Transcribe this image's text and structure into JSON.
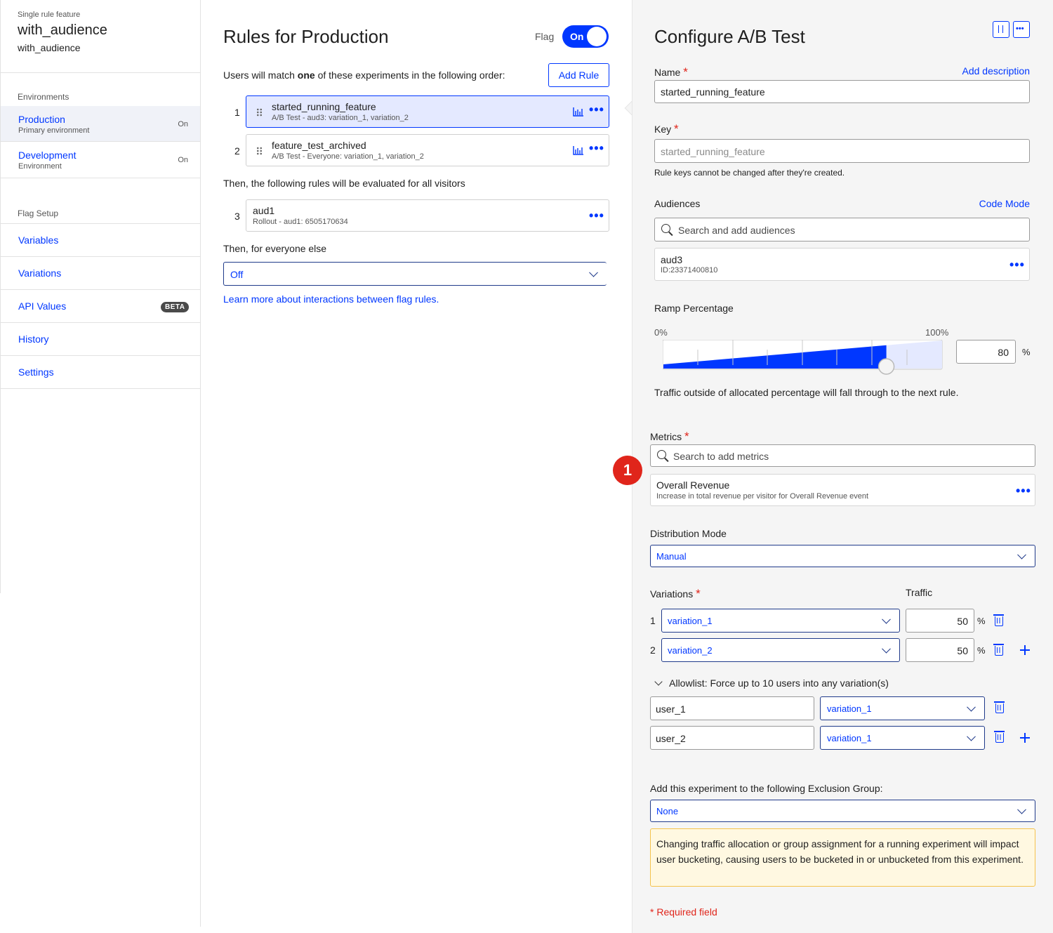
{
  "sidebar": {
    "feature_type": "Single rule feature",
    "feature_name": "with_audience",
    "feature_key": "with_audience",
    "environments_heading": "Environments",
    "environments": [
      {
        "name": "Production",
        "subtitle": "Primary environment",
        "status": "On"
      },
      {
        "name": "Development",
        "subtitle": "Environment",
        "status": "On"
      }
    ],
    "flag_setup_heading": "Flag Setup",
    "nav": [
      {
        "label": "Variables"
      },
      {
        "label": "Variations"
      },
      {
        "label": "API Values",
        "badge": "BETA"
      },
      {
        "label": "History"
      },
      {
        "label": "Settings"
      }
    ]
  },
  "rules": {
    "title": "Rules for Production",
    "flag_label": "Flag",
    "flag_toggle": "On",
    "order_text_pre": "Users will match ",
    "order_text_bold": "one",
    "order_text_post": " of these experiments in the following order:",
    "add_rule_label": "Add Rule",
    "experiments": [
      {
        "index": "1",
        "name": "started_running_feature",
        "subtitle": "A/B Test - aud3: variation_1, variation_2"
      },
      {
        "index": "2",
        "name": "feature_test_archived",
        "subtitle": "A/B Test - Everyone: variation_1, variation_2"
      }
    ],
    "then_all_text": "Then, the following rules will be evaluated for all visitors",
    "rollouts": [
      {
        "index": "3",
        "name": "aud1",
        "subtitle": "Rollout - aud1: 6505170634"
      }
    ],
    "everyone_else_text": "Then, for everyone else",
    "everyone_else_value": "Off",
    "learn_more": "Learn more about interactions between flag rules."
  },
  "configure": {
    "title": "Configure A/B Test",
    "name_label": "Name",
    "required_mark": "*",
    "add_description": "Add description",
    "name_value": "started_running_feature",
    "key_label": "Key",
    "key_value": "started_running_feature",
    "key_help": "Rule keys cannot be changed after they're created.",
    "audiences_label": "Audiences",
    "code_mode": "Code Mode",
    "audience_search_placeholder": "Search and add audiences",
    "audience": {
      "name": "aud3",
      "id": "ID:23371400810"
    },
    "ramp_label": "Ramp Percentage",
    "ramp_min": "0%",
    "ramp_max": "100%",
    "ramp_value": "80",
    "ramp_fraction": 0.8,
    "ramp_unit": "%",
    "ramp_help": "Traffic outside of allocated percentage will fall through to the next rule.",
    "metrics_label": "Metrics",
    "metrics_search_placeholder": "Search to add metrics",
    "callout_number": "1",
    "metric": {
      "name": "Overall Revenue",
      "description": "Increase in total revenue per visitor for Overall Revenue event"
    },
    "distribution_label": "Distribution Mode",
    "distribution_value": "Manual",
    "variations_label": "Variations",
    "traffic_label": "Traffic",
    "variations": [
      {
        "index": "1",
        "name": "variation_1",
        "traffic": "50",
        "unit": "%"
      },
      {
        "index": "2",
        "name": "variation_2",
        "traffic": "50",
        "unit": "%"
      }
    ],
    "allowlist_label": "Allowlist: Force up to 10 users into any variation(s)",
    "allowlist": [
      {
        "user": "user_1",
        "variation": "variation_1"
      },
      {
        "user": "user_2",
        "variation": "variation_1"
      }
    ],
    "exclusion_label": "Add this experiment to the following Exclusion Group:",
    "exclusion_value": "None",
    "warning": "Changing traffic allocation or group assignment for a running experiment will impact user bucketing, causing users to be bucketed in or unbucketed from this experiment.",
    "required_field": "* Required field"
  },
  "colors": {
    "accent": "#0037ff",
    "selected_bg": "#e4e9ff",
    "warning_bg": "#fff8e1",
    "warning_border": "#f5c24c",
    "required": "#e0251b",
    "callout": "#e0251b"
  }
}
